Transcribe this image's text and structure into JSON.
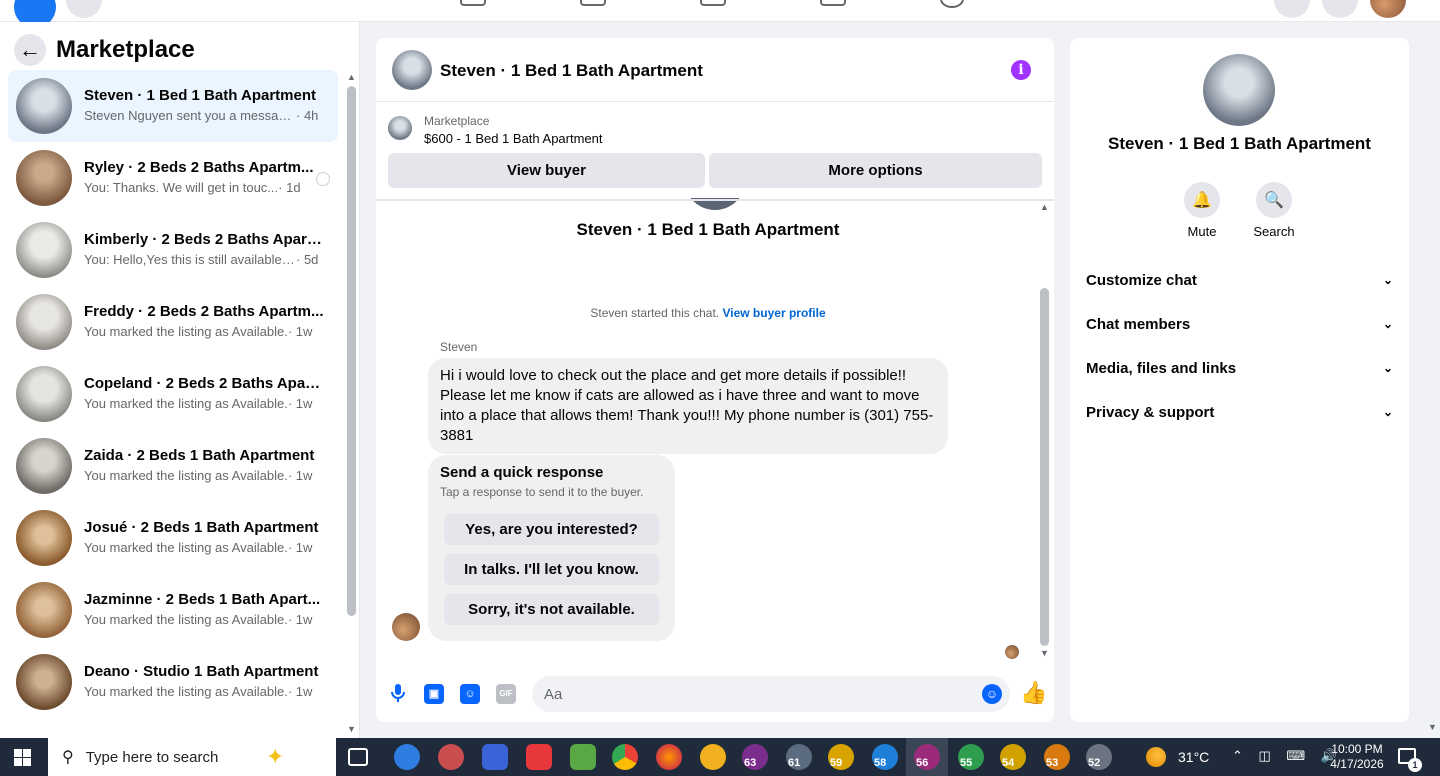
{
  "sidebar": {
    "title": "Marketplace",
    "conversations": [
      {
        "name": "Steven · 1 Bed 1 Bath Apartment",
        "snippet": "Steven Nguyen sent you a message...",
        "time": "· 4h"
      },
      {
        "name": "Ryley · 2 Beds 2 Baths Apartm...",
        "snippet": "You: Thanks. We will get in touc...",
        "time": "· 1d"
      },
      {
        "name": "Kimberly · 2 Beds 2 Baths Apart...",
        "snippet": "You: Hello,Yes this is still available P...",
        "time": "· 5d"
      },
      {
        "name": "Freddy · 2 Beds 2 Baths Apartm...",
        "snippet": "You marked the listing as Available.",
        "time": "· 1w"
      },
      {
        "name": "Copeland · 2 Beds 2 Baths Apart...",
        "snippet": "You marked the listing as Available.",
        "time": "· 1w"
      },
      {
        "name": "Zaida · 2 Beds 1 Bath Apartment",
        "snippet": "You marked the listing as Available.",
        "time": "· 1w"
      },
      {
        "name": "Josué · 2 Beds 1 Bath Apartment",
        "snippet": "You marked the listing as Available.",
        "time": "· 1w"
      },
      {
        "name": "Jazminne · 2 Beds 1 Bath Apart...",
        "snippet": "You marked the listing as Available.",
        "time": "· 1w"
      },
      {
        "name": "Deano · Studio 1 Bath Apartment",
        "snippet": "You marked the listing as Available.",
        "time": "· 1w"
      }
    ]
  },
  "chat": {
    "title": "Steven · 1 Bed 1 Bath Apartment",
    "listing": {
      "category": "Marketplace",
      "price_title": "$600 - 1 Bed 1 Bath Apartment"
    },
    "view_buyer_label": "View buyer",
    "more_options_label": "More options",
    "started_text": "Steven started this chat.",
    "view_profile_link": "View buyer profile",
    "sender": "Steven",
    "message": "Hi i would love to check out the place and get more details if possible!! Please let me know if cats are allowed as i have three and want to move into a place that allows them! Thank you!!! My phone number is (301) 755-3881",
    "quick_response": {
      "heading": "Send a quick response",
      "subheading": "Tap a response to send it to the buyer.",
      "options": [
        "Yes, are you interested?",
        "In talks. I'll let you know.",
        "Sorry, it's not available."
      ]
    },
    "composer_placeholder": "Aa",
    "gif_label": "GIF"
  },
  "info_panel": {
    "name": "Steven · 1 Bed 1 Bath Apartment",
    "actions": [
      {
        "label": "Mute",
        "icon": "bell-icon"
      },
      {
        "label": "Search",
        "icon": "search-icon"
      }
    ],
    "sections": [
      "Customize chat",
      "Chat members",
      "Media, files and links",
      "Privacy & support"
    ]
  },
  "taskbar": {
    "search_placeholder": "Type here to search",
    "app_badges": [
      "63",
      "61",
      "59",
      "58",
      "56",
      "55",
      "54",
      "53",
      "52"
    ],
    "temperature": "31°C",
    "time": "10:00 PM",
    "date": "4/17/2026",
    "notification_count": "1"
  },
  "colors": {
    "accent": "#0866ff",
    "link": "#0064d1",
    "info_purple": "#a033ff",
    "active_row": "#ebf5ff"
  }
}
